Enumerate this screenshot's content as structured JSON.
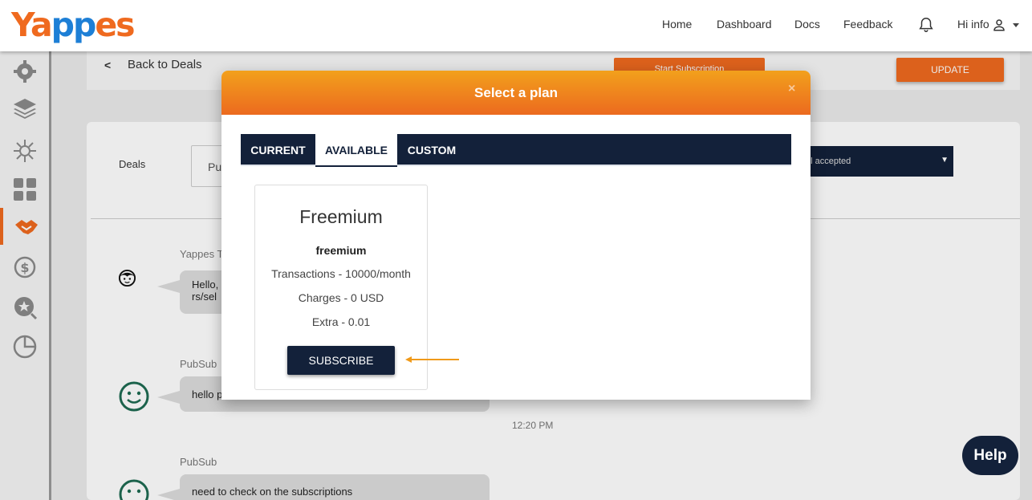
{
  "header": {
    "logo_part1": "Y",
    "logo_part2": "a",
    "logo_part3": "pp",
    "logo_part4": "es",
    "nav": [
      "Home",
      "Dashboard",
      "Docs",
      "Feedback"
    ],
    "greeting": "Hi info"
  },
  "sidebar": {
    "items": [
      "gear-icon",
      "layers-icon",
      "network-icon",
      "grid-icon",
      "handshake-icon",
      "dollar-cycle-icon",
      "star-search-icon",
      "pie-chart-icon"
    ],
    "active_index": 4,
    "accent": "#ef6a1f"
  },
  "page": {
    "back_label": "Back to Deals",
    "start_subscription_label": "Start Subscription",
    "update_label": "UPDATE",
    "deals_label": "Deals",
    "deals_input_value": "Pu",
    "deal_status_value": "al accepted",
    "messages": [
      {
        "author": "Yappes T",
        "text_line1": "Hello,",
        "text_line2": "rs/sel"
      },
      {
        "author": "PubSub",
        "text": "hello p",
        "time": "12:20 PM"
      },
      {
        "author": "PubSub",
        "text": "need to check on the subscriptions"
      }
    ],
    "help_label": "Help"
  },
  "modal": {
    "title": "Select a plan",
    "close": "×",
    "tabs": [
      "CURRENT",
      "AVAILABLE",
      "CUSTOM"
    ],
    "active_tab": "AVAILABLE",
    "plan": {
      "name": "Freemium",
      "code": "freemium",
      "transactions": "Transactions - 10000/month",
      "charges": "Charges - 0 USD",
      "extra": "Extra - 0.01",
      "subscribe_label": "SUBSCRIBE"
    }
  },
  "colors": {
    "brand_orange": "#ef6a1f",
    "brand_blue": "#1d7fd6",
    "navy": "#13213a",
    "header_gradient_top": "#f2a11c"
  }
}
